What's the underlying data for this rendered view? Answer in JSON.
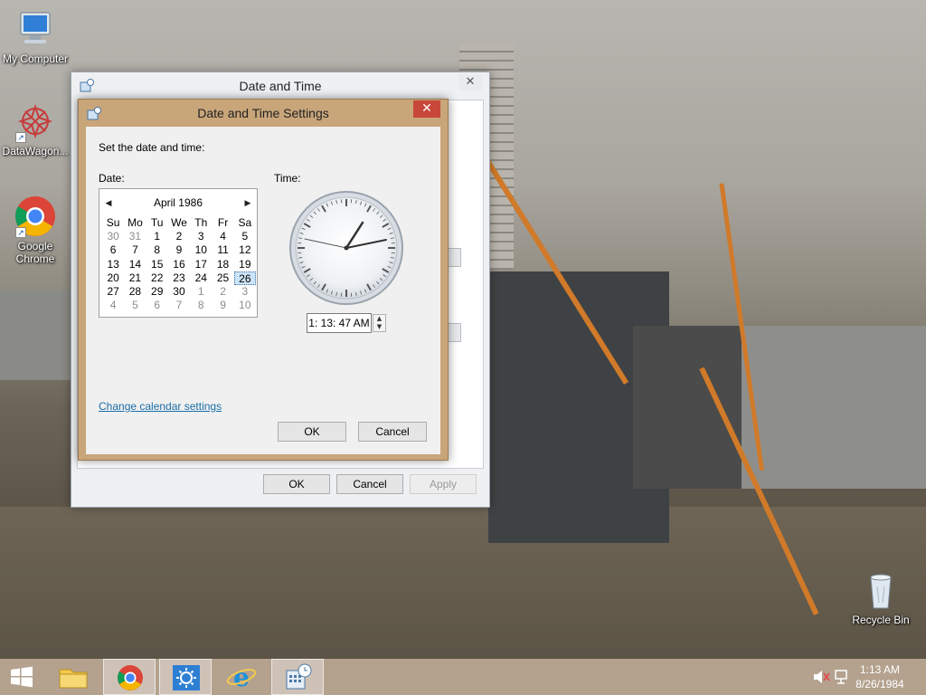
{
  "desktop": {
    "icons": [
      {
        "label": "My Computer",
        "icon": "computer-icon"
      },
      {
        "label": "DataWagon...",
        "icon": "datawagon-icon"
      },
      {
        "label": "Google Chrome",
        "icon": "chrome-icon"
      },
      {
        "label": "Recycle Bin",
        "icon": "recycle-bin-icon"
      }
    ]
  },
  "date_time_window": {
    "title": "Date and Time",
    "buttons": {
      "ok": "OK",
      "cancel": "Cancel",
      "apply": "Apply"
    }
  },
  "settings_dialog": {
    "title": "Date and Time Settings",
    "intro": "Set the date and time:",
    "date_label": "Date:",
    "time_label": "Time:",
    "calendar": {
      "month_label": "April 1986",
      "weekdays": [
        "Su",
        "Mo",
        "Tu",
        "We",
        "Th",
        "Fr",
        "Sa"
      ],
      "weeks": [
        [
          "30",
          "31",
          "1",
          "2",
          "3",
          "4",
          "5"
        ],
        [
          "6",
          "7",
          "8",
          "9",
          "10",
          "11",
          "12"
        ],
        [
          "13",
          "14",
          "15",
          "16",
          "17",
          "18",
          "19"
        ],
        [
          "20",
          "21",
          "22",
          "23",
          "24",
          "25",
          "26"
        ],
        [
          "27",
          "28",
          "29",
          "30",
          "1",
          "2",
          "3"
        ],
        [
          "4",
          "5",
          "6",
          "7",
          "8",
          "9",
          "10"
        ]
      ],
      "selected_day": "26"
    },
    "time_value": "1: 13: 47 AM",
    "change_calendar_link": "Change calendar settings",
    "buttons": {
      "ok": "OK",
      "cancel": "Cancel"
    }
  },
  "taskbar": {
    "pinned": [
      "start-icon",
      "file-explorer-icon",
      "chrome-icon",
      "weather-icon",
      "internet-explorer-icon",
      "date-time-icon"
    ],
    "clock_time": "1:13 AM",
    "clock_date": "8/26/1984"
  },
  "colors": {
    "dialog_accent": "#c9a57a",
    "close_red": "#c7473a",
    "link_blue": "#1a6ea8"
  }
}
